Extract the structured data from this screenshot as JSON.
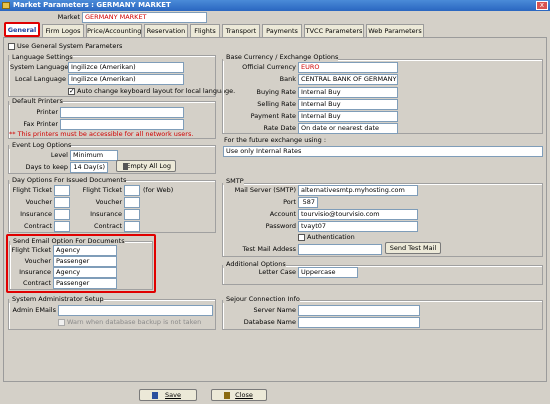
{
  "window": {
    "title": "Market Parameters : GERMANY MARKET",
    "close": "x"
  },
  "market": {
    "label": "Market",
    "value": "GERMANY MARKET"
  },
  "tabs": [
    "General",
    "Firm Logos",
    "Price/Accounting",
    "Reservation",
    "Flights",
    "Transport",
    "Payments",
    "TVCC Parameters",
    "Web Parameters"
  ],
  "use_general": "Use General System Parameters",
  "language": {
    "title": "Language Settings",
    "system_label": "System Language",
    "system_value": "Ingilizce (Amerikan)",
    "local_label": "Local Language",
    "local_value": "Ingilizce (Amerikan)",
    "auto_change": "Auto change keyboard layout for local language."
  },
  "printers": {
    "title": "Default Printers",
    "printer_label": "Printer",
    "fax_label": "Fax Printer",
    "note": "** This printers must be accessible for all network users."
  },
  "eventlog": {
    "title": "Event Log Options",
    "level_label": "Level",
    "level_value": "Minimum",
    "days_label": "Days to keep",
    "days_value": "14 Day(s)",
    "empty_btn": "Empty All Log"
  },
  "dayoptions": {
    "title": "Day Options For Issued Documents",
    "left": [
      "Flight Ticket",
      "Voucher",
      "Insurance",
      "Contract"
    ],
    "right": [
      "Flight Ticket",
      "Voucher",
      "Insurance",
      "Contract"
    ],
    "for_web": "(for Web)"
  },
  "sendemail": {
    "title": "Send Email Option For Documents",
    "rows": [
      {
        "label": "Flight Ticket",
        "value": "Agency"
      },
      {
        "label": "Voucher",
        "value": "Passenger"
      },
      {
        "label": "Insurance",
        "value": "Agency"
      },
      {
        "label": "Contract",
        "value": "Passenger"
      }
    ]
  },
  "sysadmin": {
    "title": "System Administrator Setup",
    "emails_label": "Admin EMails",
    "warn": "Warn when database backup is not taken"
  },
  "currency": {
    "title": "Base Currency / Exchange Options",
    "rows": [
      {
        "label": "Official Currency",
        "value": "EURO"
      },
      {
        "label": "Bank",
        "value": "CENTRAL BANK OF GERMANY"
      },
      {
        "label": "Buying Rate",
        "value": "Internal Buy"
      },
      {
        "label": "Selling Rate",
        "value": "Internal Buy"
      },
      {
        "label": "Payment Rate",
        "value": "Internal Buy"
      },
      {
        "label": "Rate Date",
        "value": "On date or nearest date"
      }
    ],
    "future_label": "For the future exchange using :",
    "future_value": "Use only Internal Rates"
  },
  "smtp": {
    "title": "SMTP",
    "rows": [
      {
        "label": "Mail Server (SMTP)",
        "value": "alternativesmtp.myhosting.com"
      },
      {
        "label": "Port",
        "value": "587"
      },
      {
        "label": "Account",
        "value": "tourvisio@tourvisio.com"
      },
      {
        "label": "Password",
        "value": "tvayt07"
      }
    ],
    "auth": "Authentication",
    "test_label": "Test Mail Addess",
    "test_btn": "Send Test Mail"
  },
  "additional": {
    "title": "Additional Options",
    "letter_label": "Letter Case",
    "letter_value": "Uppercase"
  },
  "sejour": {
    "title": "Sejour Connection Info",
    "server_label": "Server Name",
    "db_label": "Database Name"
  },
  "footer": {
    "save": "Save",
    "close": "Close"
  }
}
